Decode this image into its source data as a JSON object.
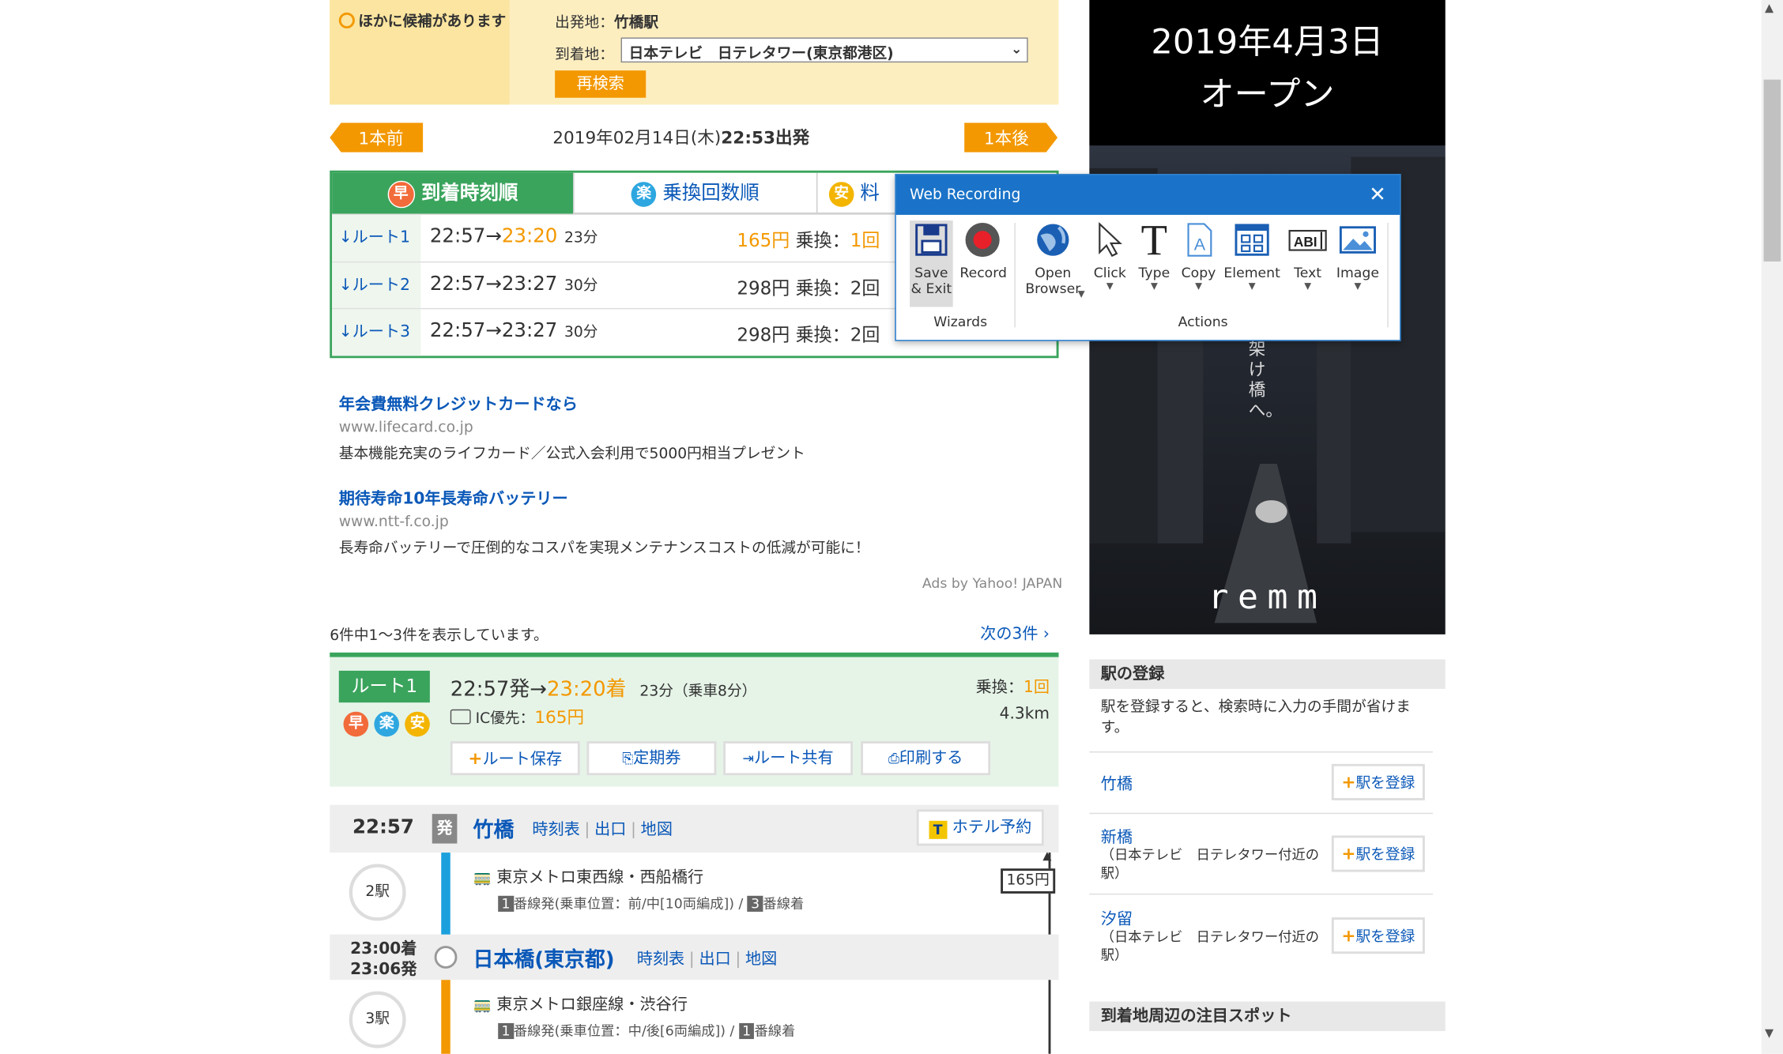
{
  "candidates": {
    "title": "ほかに候補があります",
    "origin_label": "出発地：",
    "origin_value": "竹橋駅",
    "dest_label": "到着地：",
    "dest_selected": "日本テレビ　日テレタワー(東京都港区)",
    "research_button": "再検索"
  },
  "nav": {
    "prev": "1本前",
    "next": "1本後",
    "date": "2019年02月14日(木)",
    "time": "22:53出発"
  },
  "tabs": [
    {
      "icon": "早",
      "label": "到着時刻順"
    },
    {
      "icon": "楽",
      "label": "乗換回数順"
    },
    {
      "icon": "安",
      "label": "料"
    }
  ],
  "routes": [
    {
      "label": "↓ルート1",
      "dep": "22:57→",
      "arr": "23:20",
      "mins": "23分",
      "fare": "165円",
      "transfer_label": "乗換：",
      "transfer": "1回",
      "highlight": true
    },
    {
      "label": "↓ルート2",
      "dep": "22:57→",
      "arr": "23:27",
      "mins": "30分",
      "fare": "298円",
      "transfer_label": "乗換：",
      "transfer": "2回",
      "highlight": false
    },
    {
      "label": "↓ルート3",
      "dep": "22:57→",
      "arr": "23:27",
      "mins": "30分",
      "fare": "298円",
      "transfer_label": "乗換：",
      "transfer": "2回",
      "highlight": false
    }
  ],
  "ads": [
    {
      "title": "年会費無料クレジットカードなら",
      "url": "www.lifecard.co.jp",
      "desc": "基本機能充実のライフカード／公式入会利用で5000円相当プレゼント"
    },
    {
      "title": "期待寿命10年長寿命バッテリー",
      "url": "www.ntt-f.co.jp",
      "desc": "長寿命バッテリーで圧倒的なコスパを実現メンテナンスコストの低減が可能に！"
    }
  ],
  "ads_credit": "Ads by Yahoo! JAPAN",
  "results": {
    "count_text": "6件中1〜3件を表示しています。",
    "next_link": "次の3件"
  },
  "route_detail": {
    "tag": "ルート1",
    "dep": "22:57発→",
    "arr": "23:20着",
    "duration": "23分（乗車8分）",
    "ic_label": "IC優先：",
    "ic_fare": "165円",
    "transfer_label": "乗換：",
    "transfer": "1回",
    "distance": "4.3km",
    "buttons": [
      "ルート保存",
      "定期券",
      "ルート共有",
      "印刷する"
    ]
  },
  "stations": [
    {
      "time": "22:57",
      "badge": "発",
      "name": "竹橋",
      "links": [
        "時刻表",
        "出口",
        "地図"
      ],
      "hotel": "ホテル予約"
    },
    {
      "time_arr": "23:00着",
      "time_dep": "23:06発",
      "name": "日本橋(東京都)",
      "links": [
        "時刻表",
        "出口",
        "地図"
      ]
    }
  ],
  "segments": [
    {
      "stops": "2駅",
      "line": "東京メトロ東西線・西船橋行",
      "platform_from": "1",
      "detail": "番線発(乗車位置：前/中[10両編成])",
      "platform_to": "3",
      "detail_to": "番線着",
      "fare": "165円"
    },
    {
      "stops": "3駅",
      "line": "東京メトロ銀座線・渋谷行",
      "platform_from": "1",
      "detail": "番線発(乗車位置：中/後[6両編成])",
      "platform_to": "1",
      "detail_to": "番線着"
    }
  ],
  "banner": {
    "date": "2019年4月3日",
    "open": "オープン",
    "tagline": "架け橋へ。",
    "brand": "remm"
  },
  "sidebar": {
    "register_title": "駅の登録",
    "register_desc": "駅を登録すると、検索時に入力の手間が省けます。",
    "stations": [
      {
        "name": "竹橋",
        "note": "",
        "button": "駅を登録"
      },
      {
        "name": "新橋",
        "note": "（日本テレビ　日テレタワー付近の駅）",
        "button": "駅を登録"
      },
      {
        "name": "汐留",
        "note": "（日本テレビ　日テレタワー付近の駅）",
        "button": "駅を登録"
      }
    ],
    "spots_title": "到着地周辺の注目スポット"
  },
  "web_recording": {
    "title": "Web Recording",
    "tools": [
      {
        "label": "Save\n& Exit",
        "icon": "save-icon"
      },
      {
        "label": "Record",
        "icon": "record-icon"
      },
      {
        "label": "Open\nBrowser",
        "icon": "globe-icon"
      },
      {
        "label": "Click",
        "icon": "cursor-icon"
      },
      {
        "label": "Type",
        "icon": "type-icon"
      },
      {
        "label": "Copy",
        "icon": "copy-icon"
      },
      {
        "label": "Element",
        "icon": "element-icon"
      },
      {
        "label": "Text",
        "icon": "text-icon"
      },
      {
        "label": "Image",
        "icon": "image-icon"
      }
    ],
    "groups": {
      "wizards": "Wizards",
      "actions": "Actions"
    }
  },
  "colors": {
    "accent_green": "#3aa45c",
    "accent_orange": "#f39800",
    "link_blue": "#0a58b8",
    "panel_blue": "#1a73c8"
  }
}
